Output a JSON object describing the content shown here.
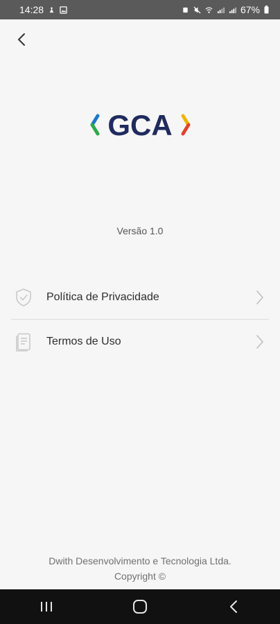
{
  "status_bar": {
    "time": "14:28",
    "battery": "67%"
  },
  "logo": {
    "text": "GCA",
    "colors": {
      "text": "#1f2a5e",
      "bracket_left_top": "#1c78c8",
      "bracket_left_bottom": "#2ea84a",
      "bracket_right_top": "#f0b400",
      "bracket_right_bottom": "#e0442a"
    }
  },
  "version_label": "Versão 1.0",
  "menu": {
    "items": [
      {
        "label": "Política de Privacidade",
        "icon": "shield-check-icon"
      },
      {
        "label": "Termos de Uso",
        "icon": "document-icon"
      }
    ]
  },
  "footer": {
    "company": "Dwith Desenvolvimento e Tecnologia Ltda.",
    "copyright": "Copyright ©"
  },
  "nav_bar": {
    "buttons": [
      "recent-apps-icon",
      "home-icon",
      "back-icon"
    ]
  }
}
